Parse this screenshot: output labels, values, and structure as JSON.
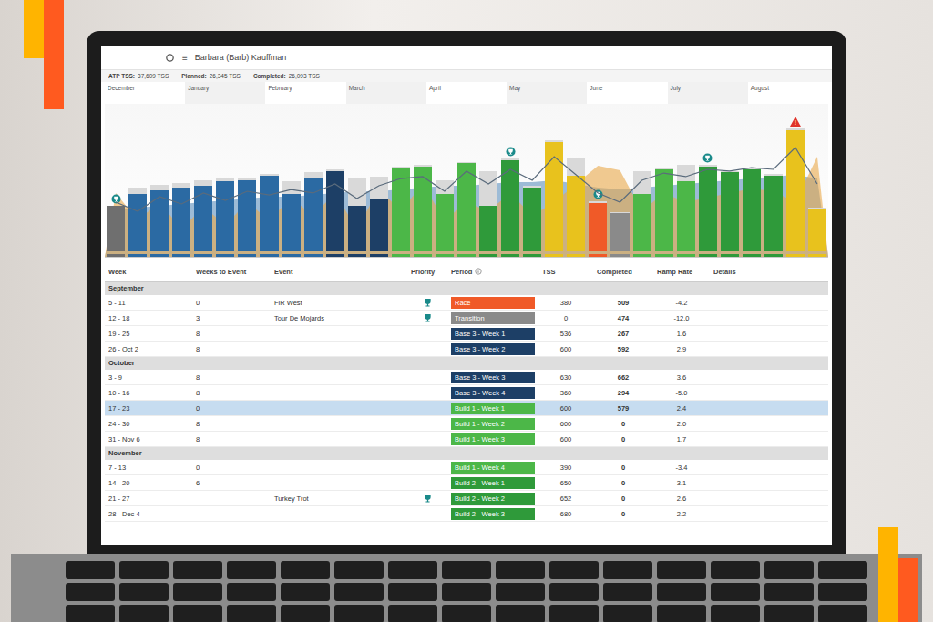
{
  "header": {
    "menu_glyph": "≡",
    "athlete": "Barbara (Barb) Kauffman"
  },
  "summary": [
    {
      "label": "ATP TSS:",
      "value": "37,609 TSS"
    },
    {
      "label": "Planned:",
      "value": "26,345 TSS"
    },
    {
      "label": "Completed:",
      "value": "26,093 TSS"
    }
  ],
  "chart": {
    "months": [
      "December",
      "January",
      "February",
      "March",
      "April",
      "May",
      "June",
      "July",
      "August"
    ],
    "alert_mark": "!",
    "bars": [
      {
        "planned": 300,
        "completed": 300,
        "color": "#6f6f6f",
        "marker": "trophy"
      },
      {
        "planned": 420,
        "completed": 380,
        "color": "#2b6aa3",
        "marker": "none"
      },
      {
        "planned": 440,
        "completed": 400,
        "color": "#2b6aa3",
        "marker": "none"
      },
      {
        "planned": 450,
        "completed": 420,
        "color": "#2b6aa3",
        "marker": "none"
      },
      {
        "planned": 470,
        "completed": 430,
        "color": "#2b6aa3",
        "marker": "none"
      },
      {
        "planned": 480,
        "completed": 460,
        "color": "#2b6aa3",
        "marker": "none"
      },
      {
        "planned": 480,
        "completed": 470,
        "color": "#2b6aa3",
        "marker": "none"
      },
      {
        "planned": 510,
        "completed": 500,
        "color": "#2b6aa3",
        "marker": "none"
      },
      {
        "planned": 460,
        "completed": 380,
        "color": "#2b6aa3",
        "marker": "none"
      },
      {
        "planned": 520,
        "completed": 480,
        "color": "#2b6aa3",
        "marker": "none"
      },
      {
        "planned": 540,
        "completed": 530,
        "color": "#1d3f66",
        "marker": "none"
      },
      {
        "planned": 480,
        "completed": 300,
        "color": "#1d3f66",
        "marker": "none"
      },
      {
        "planned": 490,
        "completed": 350,
        "color": "#1d3f66",
        "marker": "none"
      },
      {
        "planned": 560,
        "completed": 550,
        "color": "#4cb748",
        "marker": "none"
      },
      {
        "planned": 570,
        "completed": 560,
        "color": "#4cb748",
        "marker": "none"
      },
      {
        "planned": 470,
        "completed": 380,
        "color": "#4cb748",
        "marker": "none"
      },
      {
        "planned": 590,
        "completed": 580,
        "color": "#4cb748",
        "marker": "none"
      },
      {
        "planned": 530,
        "completed": 300,
        "color": "#2f9a3a",
        "marker": "none"
      },
      {
        "planned": 610,
        "completed": 600,
        "color": "#2f9a3a",
        "marker": "trophy"
      },
      {
        "planned": 430,
        "completed": 420,
        "color": "#2f9a3a",
        "marker": "none"
      },
      {
        "planned": 730,
        "completed": 720,
        "color": "#e8c21d",
        "marker": "none"
      },
      {
        "planned": 610,
        "completed": 500,
        "color": "#e8c21d",
        "marker": "none"
      },
      {
        "planned": 330,
        "completed": 320,
        "color": "#f05a28",
        "marker": "trophy"
      },
      {
        "planned": 260,
        "completed": 250,
        "color": "#8a8a8a",
        "marker": "none"
      },
      {
        "planned": 530,
        "completed": 380,
        "color": "#4cb748",
        "marker": "none"
      },
      {
        "planned": 550,
        "completed": 540,
        "color": "#4cb748",
        "marker": "none"
      },
      {
        "planned": 570,
        "completed": 460,
        "color": "#4cb748",
        "marker": "none"
      },
      {
        "planned": 570,
        "completed": 560,
        "color": "#2f9a3a",
        "marker": "trophy"
      },
      {
        "planned": 530,
        "completed": 520,
        "color": "#2f9a3a",
        "marker": "none"
      },
      {
        "planned": 550,
        "completed": 540,
        "color": "#2f9a3a",
        "marker": "none"
      },
      {
        "planned": 510,
        "completed": 500,
        "color": "#2f9a3a",
        "marker": "none"
      },
      {
        "planned": 810,
        "completed": 800,
        "color": "#e8c21d",
        "marker": "alert"
      },
      {
        "planned": 290,
        "completed": 280,
        "color": "#e8c21d",
        "marker": "none"
      }
    ],
    "fitness": [
      52,
      54,
      56,
      58,
      60,
      62,
      64,
      66,
      66,
      68,
      70,
      72,
      72,
      74,
      76,
      78,
      78,
      80,
      82,
      82,
      84,
      80,
      76,
      74,
      76,
      78,
      80,
      82,
      84,
      86,
      88,
      90,
      86
    ],
    "fatigue": [
      60,
      50,
      66,
      58,
      70,
      62,
      72,
      68,
      74,
      70,
      80,
      64,
      78,
      86,
      88,
      72,
      94,
      80,
      96,
      84,
      110,
      90,
      70,
      60,
      84,
      92,
      88,
      96,
      94,
      98,
      96,
      120,
      80
    ],
    "form": [
      70,
      40,
      60,
      30,
      55,
      35,
      60,
      40,
      65,
      45,
      70,
      30,
      75,
      50,
      80,
      40,
      60,
      50,
      70,
      45,
      60,
      80,
      100,
      95,
      50,
      70,
      60,
      65,
      70,
      75,
      72,
      60,
      110
    ]
  },
  "table": {
    "columns": [
      "Week",
      "Weeks to Event",
      "Event",
      "Priority",
      "Period",
      "TSS",
      "Completed",
      "Ramp Rate",
      "Details"
    ],
    "groups": [
      {
        "label": "September",
        "rows": [
          {
            "week": "5 - 11",
            "weeks_to_event": "0",
            "event": "FiR West",
            "priority": true,
            "period": "Race",
            "period_color": "#f05a28",
            "tss": "380",
            "completed": "509",
            "ramp_rate": "-4.2",
            "selected": false
          },
          {
            "week": "12 - 18",
            "weeks_to_event": "3",
            "event": "Tour De Mojards",
            "priority": true,
            "period": "Transition",
            "period_color": "#8a8a8a",
            "tss": "0",
            "completed": "474",
            "ramp_rate": "-12.0",
            "selected": false
          },
          {
            "week": "19 - 25",
            "weeks_to_event": "8",
            "event": "",
            "priority": false,
            "period": "Base 3 - Week 1",
            "period_color": "#1d3f66",
            "tss": "536",
            "completed": "267",
            "ramp_rate": "1.6",
            "selected": false
          },
          {
            "week": "26 - Oct 2",
            "weeks_to_event": "8",
            "event": "",
            "priority": false,
            "period": "Base 3 - Week 2",
            "period_color": "#1d3f66",
            "tss": "600",
            "completed": "592",
            "ramp_rate": "2.9",
            "selected": false
          }
        ]
      },
      {
        "label": "October",
        "rows": [
          {
            "week": "3 - 9",
            "weeks_to_event": "8",
            "event": "",
            "priority": false,
            "period": "Base 3 - Week 3",
            "period_color": "#1d3f66",
            "tss": "630",
            "completed": "662",
            "ramp_rate": "3.6",
            "selected": false
          },
          {
            "week": "10 - 16",
            "weeks_to_event": "8",
            "event": "",
            "priority": false,
            "period": "Base 3 - Week 4",
            "period_color": "#1d3f66",
            "tss": "360",
            "completed": "294",
            "ramp_rate": "-5.0",
            "selected": false
          },
          {
            "week": "17 - 23",
            "weeks_to_event": "0",
            "event": "",
            "priority": false,
            "period": "Build 1 - Week 1",
            "period_color": "#4cb748",
            "tss": "600",
            "completed": "579",
            "ramp_rate": "2.4",
            "selected": true
          },
          {
            "week": "24 - 30",
            "weeks_to_event": "8",
            "event": "",
            "priority": false,
            "period": "Build 1 - Week 2",
            "period_color": "#4cb748",
            "tss": "600",
            "completed": "0",
            "ramp_rate": "2.0",
            "selected": false
          },
          {
            "week": "31 - Nov 6",
            "weeks_to_event": "8",
            "event": "",
            "priority": false,
            "period": "Build 1 - Week 3",
            "period_color": "#4cb748",
            "tss": "600",
            "completed": "0",
            "ramp_rate": "1.7",
            "selected": false
          }
        ]
      },
      {
        "label": "November",
        "rows": [
          {
            "week": "7 - 13",
            "weeks_to_event": "0",
            "event": "",
            "priority": false,
            "period": "Build 1 - Week 4",
            "period_color": "#4cb748",
            "tss": "390",
            "completed": "0",
            "ramp_rate": "-3.4",
            "selected": false
          },
          {
            "week": "14 - 20",
            "weeks_to_event": "6",
            "event": "",
            "priority": false,
            "period": "Build 2 - Week 1",
            "period_color": "#2f9a3a",
            "tss": "650",
            "completed": "0",
            "ramp_rate": "3.1",
            "selected": false
          },
          {
            "week": "21 - 27",
            "weeks_to_event": "",
            "event": "Turkey Trot",
            "priority": true,
            "period": "Build 2 - Week 2",
            "period_color": "#2f9a3a",
            "tss": "652",
            "completed": "0",
            "ramp_rate": "2.6",
            "selected": false
          },
          {
            "week": "28 - Dec 4",
            "weeks_to_event": "",
            "event": "",
            "priority": false,
            "period": "Build 2 - Week 3",
            "period_color": "#2f9a3a",
            "tss": "680",
            "completed": "0",
            "ramp_rate": "2.2",
            "selected": false
          }
        ]
      }
    ]
  }
}
